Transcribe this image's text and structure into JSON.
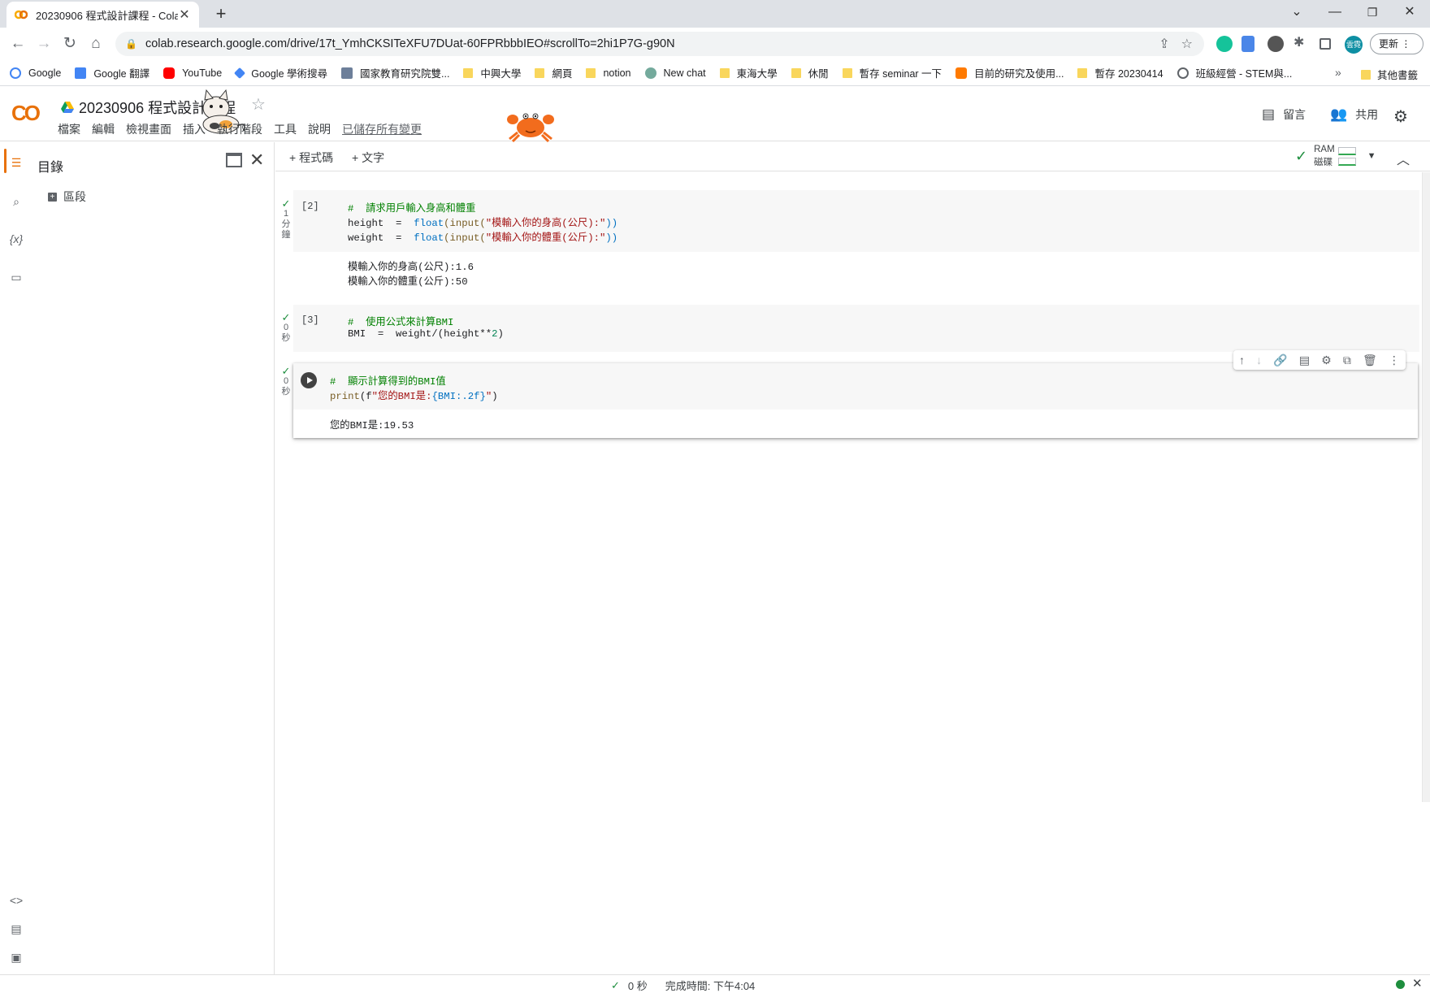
{
  "browser": {
    "tab_title": "20230906 程式設計課程 - Colab",
    "url": "colab.research.google.com/drive/17t_YmhCKSITeXFU7DUat-60FPRbbbIEO#scrollTo=2hi1P7G-g90N",
    "avatar_text": "雲霓",
    "update_label": "更新",
    "bookmarks": [
      {
        "label": "Google",
        "icon": "google-icon"
      },
      {
        "label": "Google 翻譯",
        "icon": "translate-icon"
      },
      {
        "label": "YouTube",
        "icon": "youtube-icon"
      },
      {
        "label": "Google 學術搜尋",
        "icon": "scholar-icon"
      },
      {
        "label": "國家教育研究院雙...",
        "icon": "naer-icon"
      },
      {
        "label": "中興大學",
        "icon": "folder-icon"
      },
      {
        "label": "網頁",
        "icon": "folder-icon"
      },
      {
        "label": "notion",
        "icon": "folder-icon"
      },
      {
        "label": "New chat",
        "icon": "chatgpt-icon"
      },
      {
        "label": "東海大學",
        "icon": "folder-icon"
      },
      {
        "label": "休閒",
        "icon": "folder-icon"
      },
      {
        "label": "暫存 seminar 一下",
        "icon": "folder-icon"
      },
      {
        "label": "目前的研究及使用...",
        "icon": "site-icon"
      },
      {
        "label": "暫存 20230414",
        "icon": "folder-icon"
      },
      {
        "label": "班級經營 - STEM與...",
        "icon": "globe-icon"
      }
    ],
    "more_bookmarks": "»",
    "other_bookmarks": "其他書籤"
  },
  "colab": {
    "logo": "CO",
    "title": "20230906 程式設計課程",
    "menu": [
      "檔案",
      "編輯",
      "檢視畫面",
      "插入",
      "執行階段",
      "工具",
      "說明"
    ],
    "saved_status": "已儲存所有變更",
    "comment_label": "留言",
    "share_label": "共用"
  },
  "toc": {
    "title": "目錄",
    "item": "區段"
  },
  "toolbar": {
    "add_code": "+ 程式碼",
    "add_text": "+ 文字",
    "ram_label": "RAM",
    "disk_label": "磁碟"
  },
  "cells": [
    {
      "prompt": "[2]",
      "status": [
        "1",
        "分",
        "鐘"
      ],
      "output": [
        "模輸入你的身高(公尺):1.6",
        "模輸入你的體重(公斤):50"
      ]
    },
    {
      "prompt": "[3]",
      "status": [
        "0",
        "秒"
      ]
    },
    {
      "status": [
        "0",
        "秒"
      ],
      "output": [
        "您的BMI是:19.53"
      ]
    }
  ],
  "code_text": {
    "c1_l1": "#  請求用戶輸入身高和體重",
    "c1_l2a": "height  =  ",
    "c1_l2b": "float",
    "c1_l2c": "(",
    "c1_l2d": "input",
    "c1_l2e": "(",
    "c1_l2f": "\"模輸入你的身高(公尺):\"",
    "c1_l2g": "))",
    "c1_l3a": "weight  =  ",
    "c1_l3b": "float",
    "c1_l3c": "(",
    "c1_l3d": "input",
    "c1_l3e": "(",
    "c1_l3f": "\"模輸入你的體重(公斤):\"",
    "c1_l3g": "))",
    "c2_l1": "#  使用公式來計算BMI",
    "c2_l2a": "BMI  =  weight/(height**",
    "c2_l2b": "2",
    "c2_l2c": ")",
    "c3_l1": "#  顯示計算得到的BMI值",
    "c3_l2a": "print",
    "c3_l2b": "(f",
    "c3_l2c": "\"您的BMI是:",
    "c3_l2d": "{BMI:.2f}",
    "c3_l2e": "\"",
    "c3_l2f": ")"
  },
  "statusbar": {
    "elapsed": "0 秒",
    "completed": "完成時間: 下午4:04"
  },
  "colors": {
    "accent": "#e8710a",
    "logo_yellow": "#f9ab00",
    "ok_green": "#1e8e3e",
    "comment": "#008000",
    "string": "#a31515"
  }
}
